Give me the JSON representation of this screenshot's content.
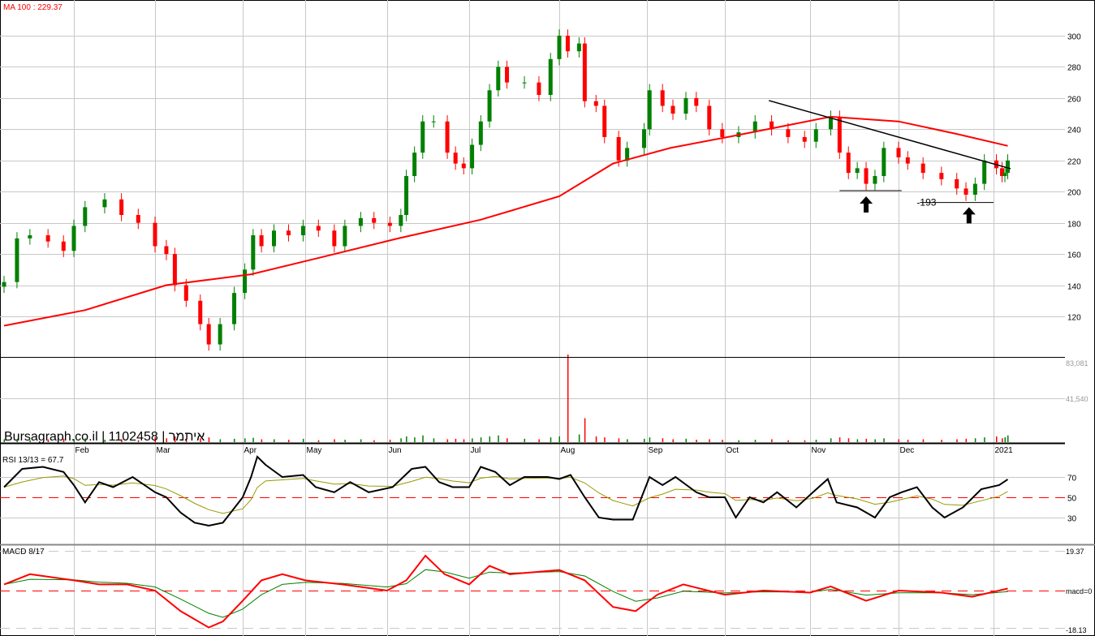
{
  "header": {
    "ma_label": "MA 100 : 229.37",
    "watermark": "Bursagraph.co.il | 1102458 | איתמר",
    "rsi_label": "RSI 13/13 = 67.7",
    "macd_label": "MACD 8/17"
  },
  "colors": {
    "up": "#008000",
    "down": "#ff0000",
    "ma": "#ff0000",
    "trend": "#000000",
    "rsi": "#000000",
    "rsi_signal": "#999900",
    "macd": "#ff0000",
    "macd_signal": "#008000"
  },
  "chart_data": [
    {
      "type": "candlestick",
      "title": "1102458",
      "ylim": [
        95,
        320
      ],
      "yticks": [
        "120",
        "140",
        "160",
        "180",
        "200",
        "220",
        "240",
        "260",
        "280",
        "300"
      ],
      "xticks": [
        {
          "label": "Feb",
          "date": "2020-02-01"
        },
        {
          "label": "Mar",
          "date": "2020-03-01"
        },
        {
          "label": "Apr",
          "date": "2020-04-01"
        },
        {
          "label": "May",
          "date": "2020-05-01"
        },
        {
          "label": "Jun",
          "date": "2020-06-01"
        },
        {
          "label": "Jul",
          "date": "2020-07-01"
        },
        {
          "label": "Aug",
          "date": "2020-08-01"
        },
        {
          "label": "Sep",
          "date": "2020-09-01"
        },
        {
          "label": "Oct",
          "date": "2020-10-01"
        },
        {
          "label": "Nov",
          "date": "2020-11-01"
        },
        {
          "label": "Dec",
          "date": "2020-12-01"
        },
        {
          "label": "2021",
          "date": "2021-01-01"
        }
      ],
      "closes": [
        [
          "2020-01-05",
          142
        ],
        [
          "2020-01-10",
          170
        ],
        [
          "2020-01-15",
          172
        ],
        [
          "2020-01-22",
          168
        ],
        [
          "2020-01-28",
          162
        ],
        [
          "2020-02-01",
          178
        ],
        [
          "2020-02-05",
          190
        ],
        [
          "2020-02-12",
          195
        ],
        [
          "2020-02-18",
          185
        ],
        [
          "2020-02-24",
          180
        ],
        [
          "2020-03-01",
          165
        ],
        [
          "2020-03-05",
          160
        ],
        [
          "2020-03-08",
          140
        ],
        [
          "2020-03-12",
          130
        ],
        [
          "2020-03-17",
          115
        ],
        [
          "2020-03-20",
          102
        ],
        [
          "2020-03-24",
          115
        ],
        [
          "2020-03-29",
          135
        ],
        [
          "2020-04-02",
          150
        ],
        [
          "2020-04-06",
          172
        ],
        [
          "2020-04-10",
          165
        ],
        [
          "2020-04-16",
          175
        ],
        [
          "2020-04-23",
          172
        ],
        [
          "2020-04-30",
          178
        ],
        [
          "2020-05-06",
          175
        ],
        [
          "2020-05-12",
          165
        ],
        [
          "2020-05-16",
          178
        ],
        [
          "2020-05-22",
          183
        ],
        [
          "2020-05-27",
          180
        ],
        [
          "2020-06-02",
          178
        ],
        [
          "2020-06-06",
          185
        ],
        [
          "2020-06-08",
          210
        ],
        [
          "2020-06-11",
          225
        ],
        [
          "2020-06-14",
          245
        ],
        [
          "2020-06-18",
          245
        ],
        [
          "2020-06-23",
          225
        ],
        [
          "2020-06-26",
          218
        ],
        [
          "2020-06-29",
          215
        ],
        [
          "2020-07-02",
          230
        ],
        [
          "2020-07-05",
          245
        ],
        [
          "2020-07-08",
          265
        ],
        [
          "2020-07-11",
          280
        ],
        [
          "2020-07-14",
          270
        ],
        [
          "2020-07-20",
          270
        ],
        [
          "2020-07-25",
          262
        ],
        [
          "2020-07-29",
          285
        ],
        [
          "2020-08-01",
          300
        ],
        [
          "2020-08-04",
          290
        ],
        [
          "2020-08-08",
          295
        ],
        [
          "2020-08-10",
          258
        ],
        [
          "2020-08-14",
          255
        ],
        [
          "2020-08-17",
          235
        ],
        [
          "2020-08-22",
          220
        ],
        [
          "2020-08-25",
          228
        ],
        [
          "2020-08-31",
          240
        ],
        [
          "2020-09-02",
          265
        ],
        [
          "2020-09-07",
          255
        ],
        [
          "2020-09-11",
          250
        ],
        [
          "2020-09-16",
          260
        ],
        [
          "2020-09-20",
          255
        ],
        [
          "2020-09-25",
          240
        ],
        [
          "2020-09-30",
          235
        ],
        [
          "2020-10-06",
          238
        ],
        [
          "2020-10-12",
          245
        ],
        [
          "2020-10-18",
          240
        ],
        [
          "2020-10-24",
          235
        ],
        [
          "2020-10-30",
          232
        ],
        [
          "2020-11-03",
          240
        ],
        [
          "2020-11-08",
          248
        ],
        [
          "2020-11-11",
          225
        ],
        [
          "2020-11-14",
          212
        ],
        [
          "2020-11-17",
          215
        ],
        [
          "2020-11-20",
          205
        ],
        [
          "2020-11-23",
          210
        ],
        [
          "2020-11-26",
          228
        ],
        [
          "2020-12-01",
          222
        ],
        [
          "2020-12-04",
          218
        ],
        [
          "2020-12-09",
          212
        ],
        [
          "2020-12-15",
          208
        ],
        [
          "2020-12-20",
          202
        ],
        [
          "2020-12-23",
          198
        ],
        [
          "2020-12-26",
          205
        ],
        [
          "2020-12-29",
          220
        ],
        [
          "2021-01-02",
          215
        ],
        [
          "2021-01-04",
          210
        ],
        [
          "2021-01-05",
          212
        ],
        [
          "2021-01-06",
          220
        ]
      ],
      "ma100": {
        "name": "MA 100",
        "points": [
          [
            "2020-01-05",
            114
          ],
          [
            "2020-02-05",
            124
          ],
          [
            "2020-03-05",
            140
          ],
          [
            "2020-04-05",
            147
          ],
          [
            "2020-05-05",
            157
          ],
          [
            "2020-06-05",
            170
          ],
          [
            "2020-07-05",
            182
          ],
          [
            "2020-08-01",
            197
          ],
          [
            "2020-08-20",
            218
          ],
          [
            "2020-09-10",
            228
          ],
          [
            "2020-10-05",
            236
          ],
          [
            "2020-10-25",
            243
          ],
          [
            "2020-11-08",
            248
          ],
          [
            "2020-12-01",
            245
          ],
          [
            "2020-12-20",
            237
          ],
          [
            "2021-01-06",
            229.37
          ]
        ]
      },
      "trendline": [
        [
          "2020-10-17",
          258.4
        ],
        [
          "2021-01-07",
          214.7
        ]
      ],
      "support_lines": [
        {
          "from": [
            "2020-11-11",
            200.6
          ],
          "to": [
            "2020-12-02",
            200.6
          ]
        },
        {
          "from": [
            "2020-12-08",
            193
          ],
          "to": [
            "2021-01-01",
            193
          ],
          "label": "-193"
        }
      ],
      "arrows": [
        [
          "2020-11-20",
          197
        ],
        [
          "2020-12-24",
          190
        ]
      ]
    },
    {
      "type": "bar",
      "title": "Volume",
      "yticks": [
        "83,081",
        "41,540"
      ],
      "ymax": 83081,
      "volumes": [
        3000,
        2500,
        2000,
        2800,
        3500,
        3000,
        4000,
        2500,
        3000,
        2000,
        5000,
        4000,
        6000,
        3500,
        4000,
        5000,
        3000,
        3500,
        4000,
        4500,
        3000,
        3000,
        2500,
        3500,
        2000,
        3000,
        2500,
        3000,
        2000,
        2500,
        4000,
        6000,
        5000,
        7000,
        4000,
        3000,
        3500,
        3000,
        4000,
        5000,
        6000,
        7000,
        4000,
        3500,
        3000,
        5000,
        6000,
        110000,
        8000,
        25000,
        6000,
        5000,
        4000,
        3000,
        3500,
        5000,
        4000,
        3000,
        3500,
        2500,
        3000,
        2500,
        2000,
        2500,
        3000,
        2000,
        2000,
        2500,
        4000,
        5000,
        4000,
        3000,
        3500,
        3000,
        4000,
        3000,
        2500,
        3000,
        2500,
        3000,
        3500,
        4000,
        5000,
        6000,
        4000,
        5000,
        7000
      ]
    },
    {
      "type": "line",
      "title": "RSI 13/13",
      "ylim": [
        10,
        100
      ],
      "yticks": [
        "70",
        "50",
        "30"
      ],
      "points": [
        [
          "2020-01-05",
          60
        ],
        [
          "2020-01-12",
          78
        ],
        [
          "2020-01-20",
          80
        ],
        [
          "2020-01-28",
          75
        ],
        [
          "2020-02-01",
          62
        ],
        [
          "2020-02-05",
          45
        ],
        [
          "2020-02-10",
          65
        ],
        [
          "2020-02-15",
          60
        ],
        [
          "2020-02-22",
          70
        ],
        [
          "2020-03-01",
          55
        ],
        [
          "2020-03-05",
          50
        ],
        [
          "2020-03-10",
          35
        ],
        [
          "2020-03-15",
          25
        ],
        [
          "2020-03-20",
          22
        ],
        [
          "2020-03-25",
          25
        ],
        [
          "2020-04-01",
          50
        ],
        [
          "2020-04-05",
          70
        ],
        [
          "2020-04-08",
          90
        ],
        [
          "2020-04-12",
          82
        ],
        [
          "2020-04-20",
          70
        ],
        [
          "2020-04-30",
          72
        ],
        [
          "2020-05-05",
          60
        ],
        [
          "2020-05-12",
          55
        ],
        [
          "2020-05-18",
          65
        ],
        [
          "2020-05-25",
          55
        ],
        [
          "2020-06-03",
          60
        ],
        [
          "2020-06-10",
          78
        ],
        [
          "2020-06-15",
          80
        ],
        [
          "2020-06-20",
          65
        ],
        [
          "2020-06-25",
          60
        ],
        [
          "2020-07-01",
          60
        ],
        [
          "2020-07-05",
          80
        ],
        [
          "2020-07-10",
          75
        ],
        [
          "2020-07-15",
          62
        ],
        [
          "2020-07-20",
          70
        ],
        [
          "2020-07-28",
          70
        ],
        [
          "2020-08-01",
          68
        ],
        [
          "2020-08-05",
          72
        ],
        [
          "2020-08-10",
          50
        ],
        [
          "2020-08-15",
          30
        ],
        [
          "2020-08-20",
          28
        ],
        [
          "2020-08-27",
          28
        ],
        [
          "2020-09-02",
          70
        ],
        [
          "2020-09-07",
          62
        ],
        [
          "2020-09-12",
          70
        ],
        [
          "2020-09-20",
          55
        ],
        [
          "2020-09-25",
          50
        ],
        [
          "2020-10-01",
          50
        ],
        [
          "2020-10-05",
          30
        ],
        [
          "2020-10-10",
          50
        ],
        [
          "2020-10-15",
          45
        ],
        [
          "2020-10-20",
          55
        ],
        [
          "2020-10-27",
          40
        ],
        [
          "2020-11-02",
          55
        ],
        [
          "2020-11-07",
          68
        ],
        [
          "2020-11-10",
          45
        ],
        [
          "2020-11-17",
          40
        ],
        [
          "2020-11-23",
          30
        ],
        [
          "2020-11-28",
          50
        ],
        [
          "2020-12-02",
          55
        ],
        [
          "2020-12-07",
          60
        ],
        [
          "2020-12-12",
          40
        ],
        [
          "2020-12-16",
          30
        ],
        [
          "2020-12-22",
          40
        ],
        [
          "2020-12-28",
          58
        ],
        [
          "2021-01-03",
          62
        ],
        [
          "2021-01-06",
          67.7
        ]
      ]
    },
    {
      "type": "line",
      "title": "MACD 8/17",
      "ylim": [
        -18.13,
        19.37
      ],
      "yticks": [
        "19.37",
        "macd=0",
        "-18.13"
      ],
      "points": [
        [
          "2020-01-05",
          3
        ],
        [
          "2020-01-15",
          8
        ],
        [
          "2020-02-01",
          5
        ],
        [
          "2020-02-10",
          3
        ],
        [
          "2020-02-20",
          3
        ],
        [
          "2020-03-01",
          0
        ],
        [
          "2020-03-10",
          -10
        ],
        [
          "2020-03-20",
          -18
        ],
        [
          "2020-03-25",
          -15
        ],
        [
          "2020-04-01",
          -5
        ],
        [
          "2020-04-10",
          5
        ],
        [
          "2020-04-20",
          8
        ],
        [
          "2020-05-01",
          5
        ],
        [
          "2020-05-15",
          3
        ],
        [
          "2020-06-01",
          0
        ],
        [
          "2020-06-08",
          5
        ],
        [
          "2020-06-15",
          17
        ],
        [
          "2020-06-22",
          8
        ],
        [
          "2020-07-01",
          3
        ],
        [
          "2020-07-08",
          12
        ],
        [
          "2020-07-15",
          8
        ],
        [
          "2020-08-01",
          10
        ],
        [
          "2020-08-10",
          5
        ],
        [
          "2020-08-20",
          -8
        ],
        [
          "2020-08-28",
          -10
        ],
        [
          "2020-09-05",
          -2
        ],
        [
          "2020-09-15",
          3
        ],
        [
          "2020-10-01",
          -2
        ],
        [
          "2020-10-15",
          0
        ],
        [
          "2020-11-01",
          -1
        ],
        [
          "2020-11-08",
          2
        ],
        [
          "2020-11-20",
          -5
        ],
        [
          "2020-12-01",
          0
        ],
        [
          "2020-12-15",
          -1
        ],
        [
          "2020-12-25",
          -3
        ],
        [
          "2021-01-06",
          1
        ]
      ]
    }
  ]
}
